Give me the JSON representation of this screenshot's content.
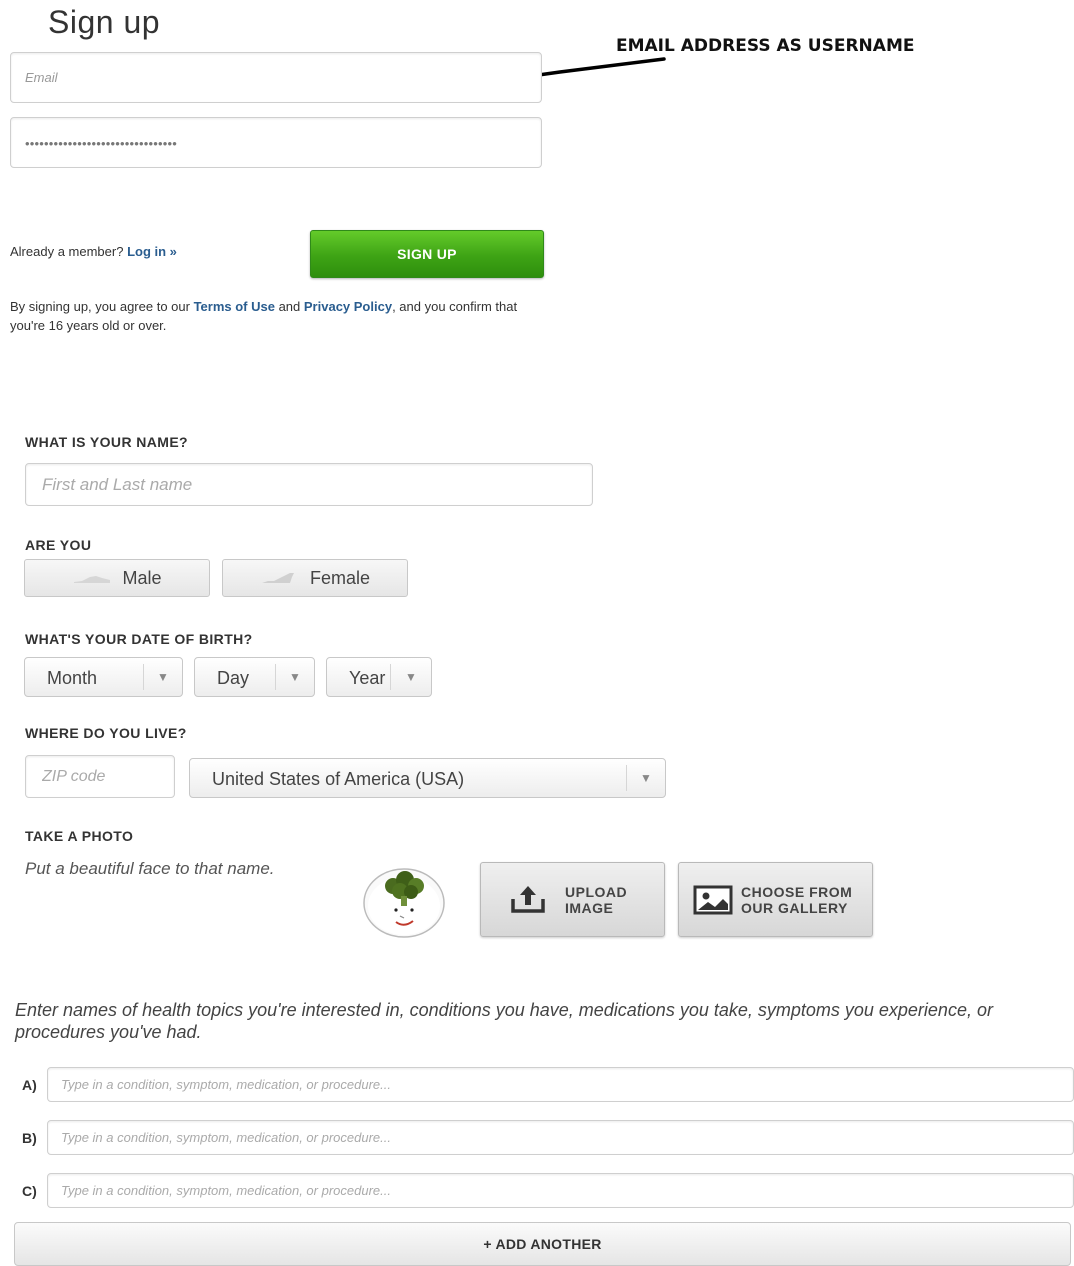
{
  "page": {
    "title": "Sign up"
  },
  "annotation": {
    "text": "EMAIL ADDRESS  AS  USERNAME"
  },
  "account": {
    "email_placeholder": "Email",
    "password_mask": "••••••••••••••••••••••••••••••••"
  },
  "login": {
    "prompt": "Already a member?",
    "link": "Log in »"
  },
  "signup_button": "SIGN UP",
  "terms": {
    "prefix": "By signing up, you agree to our ",
    "terms_link": "Terms of Use",
    "middle": " and ",
    "privacy_link": "Privacy Policy",
    "suffix": ", and you confirm that you're 16 years old or over."
  },
  "name_section": {
    "label": "WHAT IS YOUR NAME?",
    "placeholder": "First and Last name"
  },
  "gender_section": {
    "label": "ARE YOU",
    "male": "Male",
    "female": "Female"
  },
  "dob_section": {
    "label": "WHAT'S YOUR DATE OF BIRTH?",
    "month": "Month",
    "day": "Day",
    "year": "Year"
  },
  "location_section": {
    "label": "WHERE DO YOU LIVE?",
    "zip_placeholder": "ZIP code",
    "country": "United States of America (USA)"
  },
  "photo_section": {
    "label": "TAKE A PHOTO",
    "note": "Put a beautiful face to that name.",
    "upload_line1": "UPLOAD",
    "upload_line2": "IMAGE",
    "gallery_line1": "CHOOSE FROM",
    "gallery_line2": "OUR GALLERY"
  },
  "health_section": {
    "intro": "Enter names of health topics you're interested in, conditions you have, medications you take, symptoms you experience, or procedures you've had.",
    "topics": [
      {
        "letter": "A)",
        "placeholder": "Type in a condition, symptom, medication, or procedure..."
      },
      {
        "letter": "B)",
        "placeholder": "Type in a condition, symptom, medication, or procedure..."
      },
      {
        "letter": "C)",
        "placeholder": "Type in a condition, symptom, medication, or procedure..."
      }
    ],
    "add_button": "+ ADD ANOTHER"
  },
  "colors": {
    "accent_green": "#3ea315",
    "link_blue": "#2a5d8f"
  },
  "icons": [
    "dropdown-arrow-icon",
    "male-shoe-icon",
    "female-shoe-icon",
    "upload-icon",
    "gallery-image-icon",
    "avatar-broccoli-face"
  ]
}
